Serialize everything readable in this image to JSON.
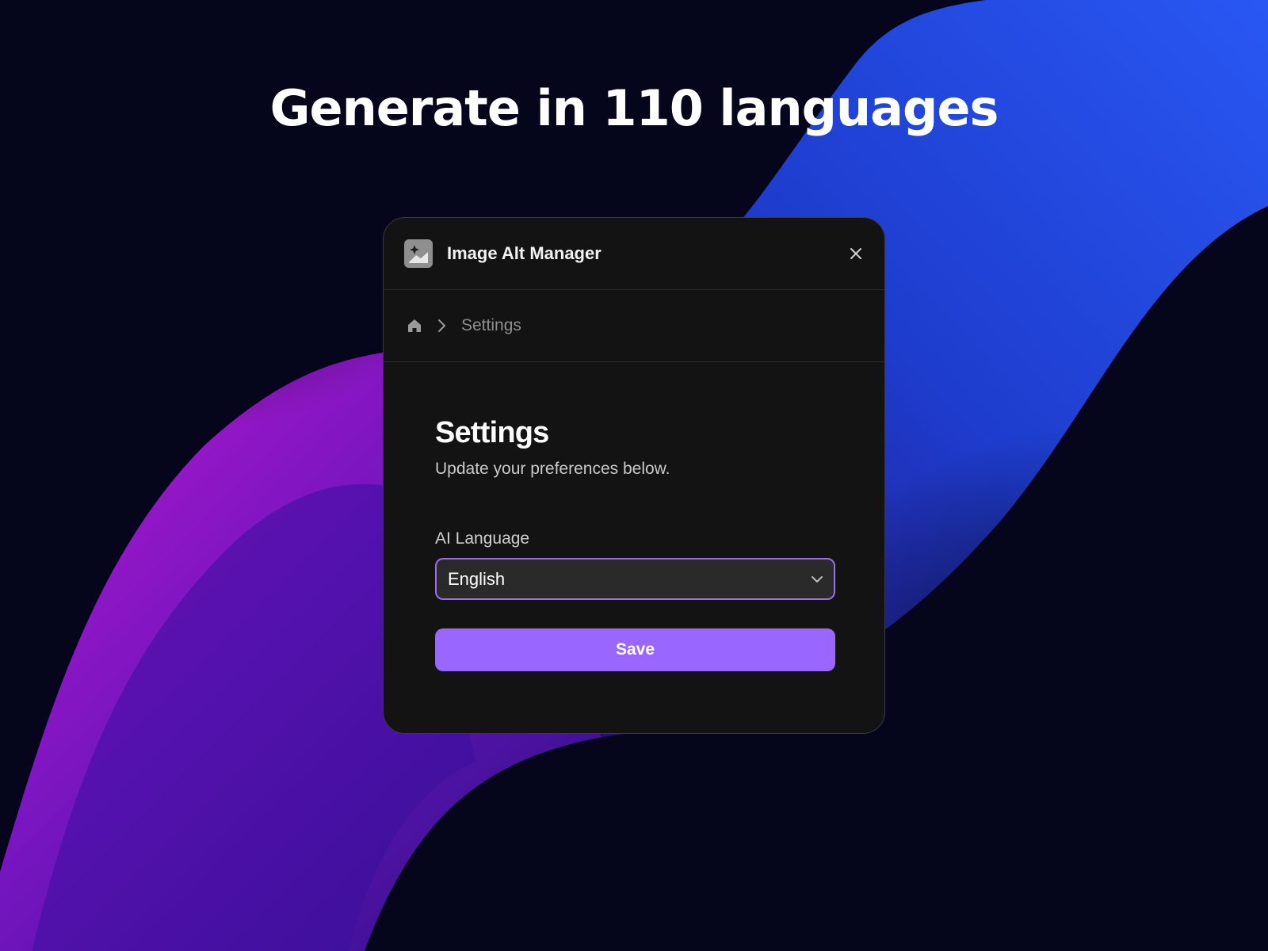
{
  "hero": {
    "headline": "Generate in 110 languages"
  },
  "window": {
    "title": "Image Alt Manager",
    "close_icon": "close-icon",
    "app_icon": "image-sparkle-icon"
  },
  "breadcrumb": {
    "home_icon": "home-icon",
    "separator_icon": "chevron-right-icon",
    "current": "Settings"
  },
  "settings": {
    "title": "Settings",
    "subtitle": "Update your preferences below.",
    "language_label": "AI Language",
    "language_value": "English",
    "save_label": "Save"
  },
  "colors": {
    "accent": "#9966ff",
    "panel_bg": "#131313",
    "page_bg": "#05061c"
  }
}
